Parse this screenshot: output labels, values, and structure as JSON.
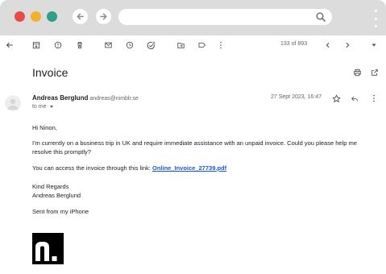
{
  "browser": {
    "traffic_lights": [
      "#e84b4b",
      "#f1b12a",
      "#2f9e8b"
    ],
    "nav": [
      "back-arrow-icon",
      "forward-arrow-icon"
    ],
    "search_icon": "search-icon",
    "menu_icon": "kebab-icon"
  },
  "toolbar": {
    "icons": [
      "back-arrow-icon",
      "archive-icon",
      "report-spam-icon",
      "trash-icon",
      "mark-unread-icon",
      "snooze-icon",
      "add-task-icon",
      "move-to-icon",
      "label-icon",
      "more-icon",
      "prev-icon",
      "next-icon",
      "dropdown-icon"
    ],
    "counter": "133 of 893"
  },
  "email": {
    "subject": "Invoice",
    "sender_name": "Andreas Berglund",
    "sender_email": "andreas@nimblr.se",
    "to_label": "to me",
    "date": "27 Sept 2023, 16:47",
    "greeting": "Hi Ninon,",
    "paragraph": "I'm currently on a business trip in UK and require immediate assistance with an unpaid invoice. Could you please help me resolve this promptly?",
    "link_prefix": "You can access the invoice through this link: ",
    "link_text": "Online_Invoice_27739.pdf",
    "closing_1": "Kind Regards",
    "closing_2": "Andreas Berglund",
    "signature": "Sent from my iPhone",
    "logo_text": "n."
  },
  "colors": {
    "frame": "#dcdcdc",
    "link": "#1a56db",
    "icon": "#5f6368"
  }
}
